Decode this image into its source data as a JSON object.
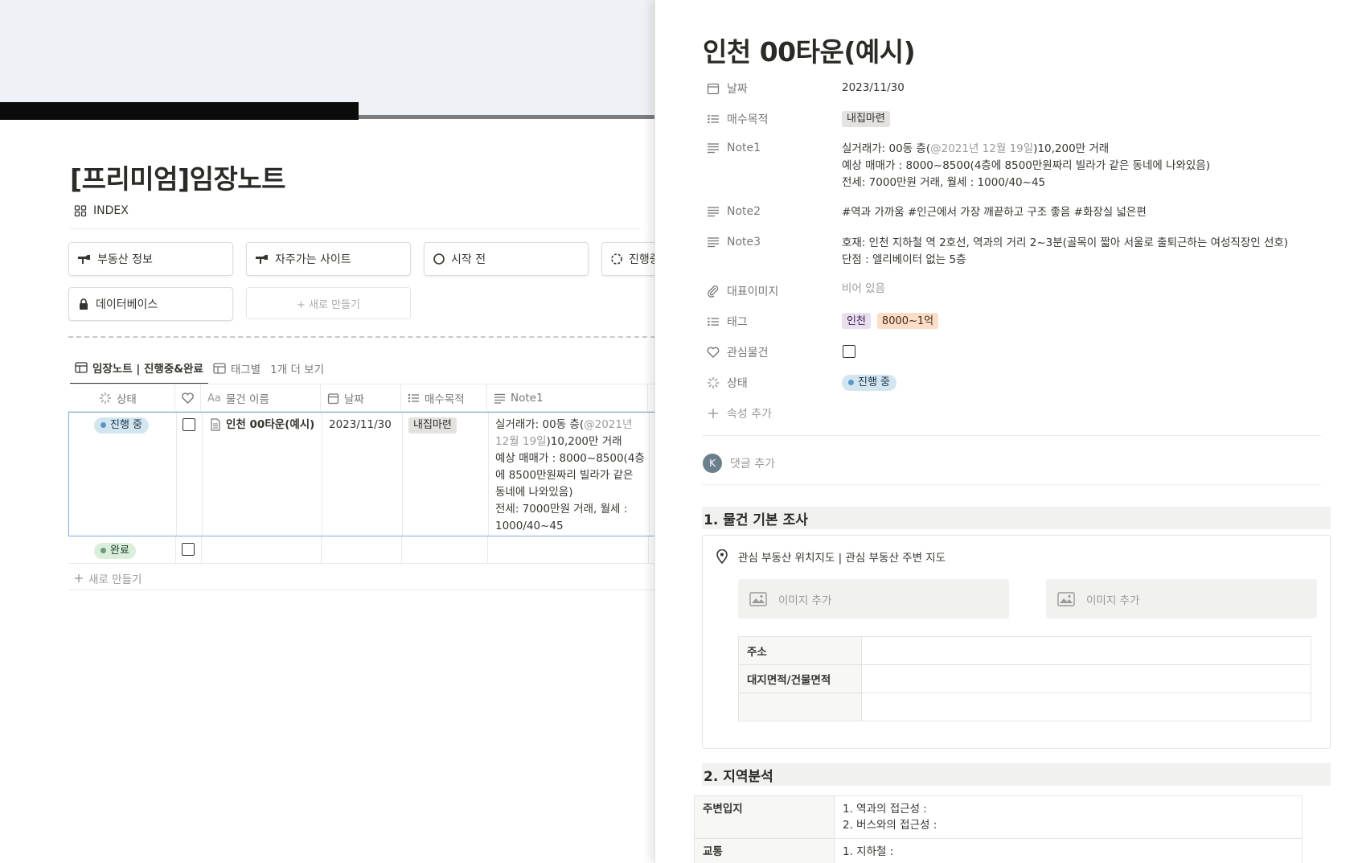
{
  "left_page": {
    "title": "[프리미엄]임장노트",
    "index_label": "INDEX",
    "buttons": [
      {
        "label": "부동산 정보",
        "icon": "pointing-hand-icon"
      },
      {
        "label": "자주가는 사이트",
        "icon": "pointing-hand-icon"
      },
      {
        "label": "시작 전",
        "icon": "circle-icon"
      },
      {
        "label": "진행중",
        "icon": "dashed-circle-icon"
      },
      {
        "label": "데이터베이스",
        "icon": "lock-icon"
      }
    ],
    "new_button_label": "+ 새로 만들기",
    "tabs": [
      {
        "label": "임장노트 | 진행중&완료"
      },
      {
        "label": "태그별"
      },
      {
        "label": "1개 더 보기"
      }
    ],
    "columns": [
      "상태",
      "",
      "물건 이름",
      "날짜",
      "매수목적",
      "Note1"
    ],
    "name_prefix": "Aa",
    "rows": [
      {
        "status": "진행 중",
        "name": "인천 00타운(예시)",
        "date": "2023/11/30",
        "purpose": "내집마련",
        "note1_lines": [
          "실거래가: 00동 층(",
          "@2021년",
          "12월 19일",
          ")10,200만 거래",
          "예상 매매가 : 8000~8500(4층",
          "에 8500만원짜리 빌라가 같은",
          "동네에 나와있음)",
          "전세: 7000만원 거래, 월세 :",
          "1000/40~45"
        ]
      },
      {
        "status": "완료"
      }
    ],
    "new_row_label": "새로 만들기"
  },
  "peek": {
    "title": "인천 00타운(예시)",
    "properties": {
      "date_label": "날짜",
      "date_value": "2023/11/30",
      "purpose_label": "매수목적",
      "purpose_value": "내집마련",
      "note1_label": "Note1",
      "note1_line1_a": "실거래가: 00동 층(",
      "note1_line1_mention": "@2021년 12월 19일",
      "note1_line1_b": ")10,200만 거래",
      "note1_line2": "예상 매매가 : 8000~8500(4층에 8500만원짜리 빌라가 같은 동네에 나와있음)",
      "note1_line3": "전세: 7000만원 거래, 월세 : 1000/40~45",
      "note2_label": "Note2",
      "note2_value": "#역과 가까움 #인근에서 가장 깨끝하고 구조 좋음 #화장실 넓은편",
      "note3_label": "Note3",
      "note3_line1": "호재:  인천 지하철 역 2호선, 역과의 거리 2~3분(골목이 짧아 서울로 출퇴근하는 여성직장인 선호)",
      "note3_line2": "단점 : 엘리베이터 없는 5층",
      "image_label": "대표이미지",
      "image_value": "비어 있음",
      "tag_label": "태그",
      "tag1": "인천",
      "tag2": "8000~1억",
      "fav_label": "관심물건",
      "status_label": "상태",
      "status_value": "진행 중",
      "add_prop_label": "속성 추가"
    },
    "comment": {
      "avatar": "K",
      "placeholder": "댓글 추가"
    },
    "section1": {
      "heading": "1. 물건 기본 조사",
      "callout_text": "관심 부동산 위치지도 | 관심 부동산 주변 지도",
      "image_add_1": "이미지 추가",
      "image_add_2": "이미지 추가",
      "rows": [
        "주소",
        "대지면적/건물면적",
        ""
      ]
    },
    "section2": {
      "heading": "2. 지역분석",
      "rows": [
        {
          "label": "주변입지",
          "lines": [
            "1. 역과의 접근성 :",
            "2. 버스와의 접근성 :"
          ]
        },
        {
          "label": "교통",
          "lines": [
            "1. 지하철 :"
          ]
        }
      ]
    }
  },
  "colors": {
    "accent_blue": "#7ea9e3",
    "status_blue_bg": "#d3e5ef",
    "status_green_bg": "#dbeddb",
    "tag_gray_bg": "#e3e2e0"
  }
}
